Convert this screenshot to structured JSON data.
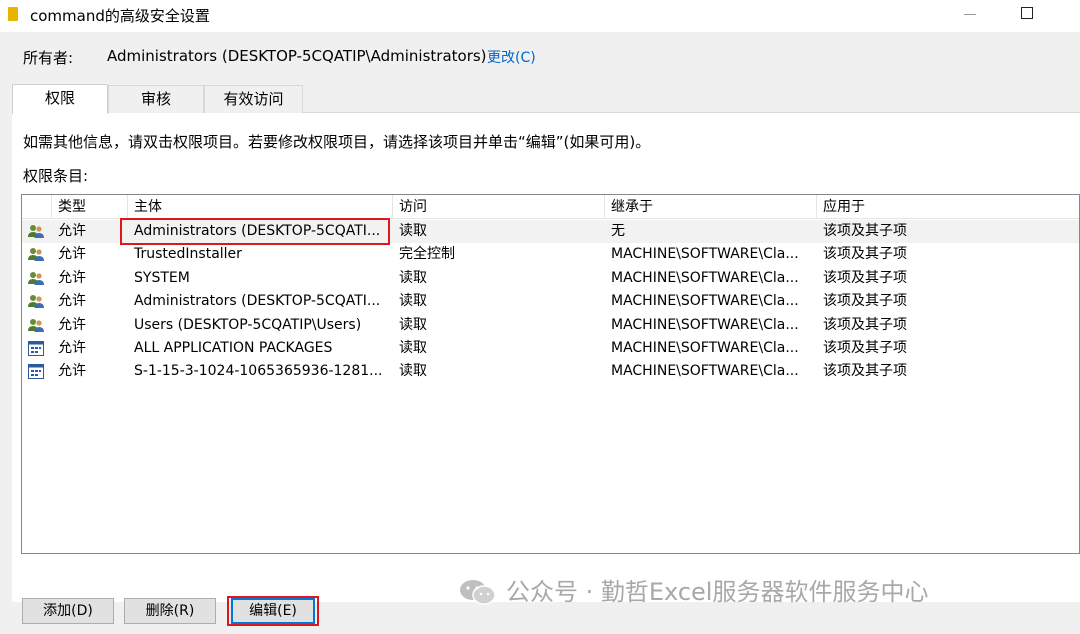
{
  "window": {
    "title": "command的高级安全设置"
  },
  "owner": {
    "label": "所有者:",
    "value": "Administrators (DESKTOP-5CQATIP\\Administrators)",
    "change_link": "更改(C)"
  },
  "tabs": [
    {
      "label": "权限",
      "active": true
    },
    {
      "label": "审核",
      "active": false
    },
    {
      "label": "有效访问",
      "active": false
    }
  ],
  "info_text": "如需其他信息，请双击权限项目。若要修改权限项目，请选择该项目并单击“编辑”(如果可用)。",
  "entries_label": "权限条目:",
  "table": {
    "headers": [
      "类型",
      "主体",
      "访问",
      "继承于",
      "应用于"
    ],
    "rows": [
      {
        "icon": "user-group-icon",
        "type": "允许",
        "principal": "Administrators (DESKTOP-5CQATI...",
        "access": "读取",
        "inherited": "无",
        "applies": "该项及其子项",
        "selected": true
      },
      {
        "icon": "user-group-icon",
        "type": "允许",
        "principal": "TrustedInstaller",
        "access": "完全控制",
        "inherited": "MACHINE\\SOFTWARE\\Cla...",
        "applies": "该项及其子项",
        "selected": false
      },
      {
        "icon": "user-group-icon",
        "type": "允许",
        "principal": "SYSTEM",
        "access": "读取",
        "inherited": "MACHINE\\SOFTWARE\\Cla...",
        "applies": "该项及其子项",
        "selected": false
      },
      {
        "icon": "user-group-icon",
        "type": "允许",
        "principal": "Administrators (DESKTOP-5CQATI...",
        "access": "读取",
        "inherited": "MACHINE\\SOFTWARE\\Cla...",
        "applies": "该项及其子项",
        "selected": false
      },
      {
        "icon": "user-group-icon",
        "type": "允许",
        "principal": "Users (DESKTOP-5CQATIP\\Users)",
        "access": "读取",
        "inherited": "MACHINE\\SOFTWARE\\Cla...",
        "applies": "该项及其子项",
        "selected": false
      },
      {
        "icon": "app-package-icon",
        "type": "允许",
        "principal": "ALL APPLICATION PACKAGES",
        "access": "读取",
        "inherited": "MACHINE\\SOFTWARE\\Cla...",
        "applies": "该项及其子项",
        "selected": false
      },
      {
        "icon": "app-package-icon",
        "type": "允许",
        "principal": "S-1-15-3-1024-1065365936-1281...",
        "access": "读取",
        "inherited": "MACHINE\\SOFTWARE\\Cla...",
        "applies": "该项及其子项",
        "selected": false
      }
    ]
  },
  "buttons": {
    "add": "添加(D)",
    "remove": "删除(R)",
    "edit": "编辑(E)"
  },
  "watermark": {
    "text": "公众号 · 勤哲Excel服务器软件服务中心"
  },
  "colors": {
    "highlight_border": "#e0161c",
    "link": "#0066cc"
  }
}
